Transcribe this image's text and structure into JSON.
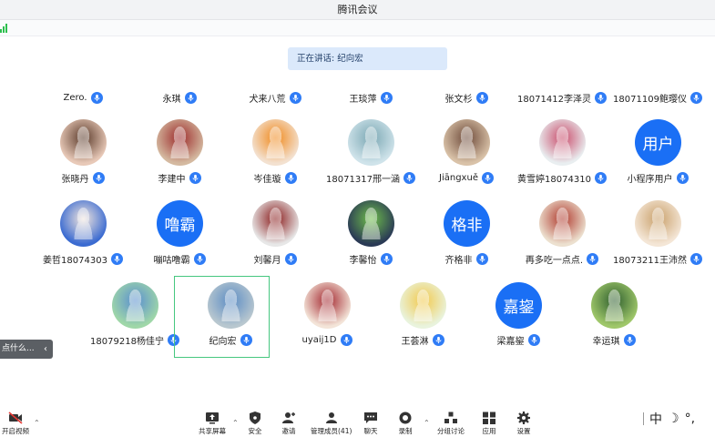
{
  "window": {
    "title": "腾讯会议"
  },
  "speaking": {
    "text": "正在讲话: 纪向宏"
  },
  "participants": [
    {
      "name": "Zero.",
      "avatar": null
    },
    {
      "name": "永琪",
      "avatar": null
    },
    {
      "name": "犬来八荒",
      "avatar": null
    },
    {
      "name": "王琰萍",
      "avatar": null
    },
    {
      "name": "张文杉",
      "avatar": null
    },
    {
      "name": "18071412李泽灵",
      "avatar": null
    },
    {
      "name": "18071109鲍璎仪",
      "avatar": null
    },
    {
      "name": "张晓丹",
      "avatar": "photo"
    },
    {
      "name": "李建中",
      "avatar": "photo"
    },
    {
      "name": "岑佳璇",
      "avatar": "photo"
    },
    {
      "name": "18071317邢一涵",
      "avatar": "photo"
    },
    {
      "name": "Jiāngxuě",
      "avatar": "photo"
    },
    {
      "name": "黄雪婷18074310",
      "avatar": "photo"
    },
    {
      "name": "小程序用户",
      "avatar": "用户"
    },
    {
      "name": "姜哲18074303",
      "avatar": "photo"
    },
    {
      "name": "嘣咕噜霸",
      "avatar": "噜霸"
    },
    {
      "name": "刘馨月",
      "avatar": "photo"
    },
    {
      "name": "李馨怡",
      "avatar": "photo"
    },
    {
      "name": "齐格非",
      "avatar": "格非"
    },
    {
      "name": "再多吃一点点.",
      "avatar": "photo"
    },
    {
      "name": "18073211王沛然",
      "avatar": "photo"
    },
    {
      "name": "18079218杨佳宁",
      "avatar": "photo"
    },
    {
      "name": "纪向宏",
      "avatar": "photo"
    },
    {
      "name": "uyaij1D",
      "avatar": "photo"
    },
    {
      "name": "王荟淋",
      "avatar": "photo"
    },
    {
      "name": "梁嘉鋆",
      "avatar": "嘉鋆"
    },
    {
      "name": "幸运琪",
      "avatar": "photo"
    }
  ],
  "side_panel": {
    "text": "点什么..."
  },
  "toolbar": {
    "video": "开启视频",
    "share": "共享屏幕",
    "security": "安全",
    "invite": "邀请",
    "members": "管理成员(41)",
    "chat": "聊天",
    "record": "录制",
    "breakout": "分组讨论",
    "apps": "应用",
    "settings": "设置"
  },
  "ime": {
    "mode": "中",
    "moon": "☽",
    "punct": "°,"
  },
  "colors": {
    "accent": "#1a6ff5",
    "speaking_bg": "#dbe9fb",
    "active_border": "#46c77f",
    "signal": "#2dbf4e"
  },
  "icons": [
    "mic-icon",
    "camera-off-icon",
    "share-screen-icon",
    "shield-icon",
    "add-user-icon",
    "people-icon",
    "chat-icon",
    "record-icon",
    "breakout-icon",
    "apps-icon",
    "gear-icon",
    "chevron-left-icon",
    "chevron-up-icon",
    "signal-icon"
  ]
}
